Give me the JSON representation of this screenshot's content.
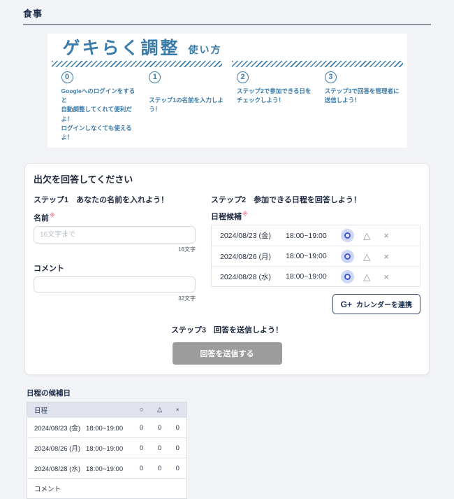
{
  "colors": {
    "accent_blue": "#3b7ca9",
    "selected_blue": "#4457d2",
    "selected_halo": "#cdd7f7",
    "required_red": "#ee8296",
    "disabled_gray": "#9c9c9c",
    "navy_text": "#1b2a4a",
    "page_background": "#f2f3f6"
  },
  "page": {
    "title": "食事"
  },
  "banner": {
    "title": "ゲキらく調整",
    "subtitle": "使い方",
    "steps": [
      {
        "number": "0",
        "lines": [
          "Googleへのログインをすると",
          "自動調整してくれて便利だよ！",
          "ログインしなくても使えるよ！"
        ]
      },
      {
        "number": "1",
        "lines": [
          "ステップ1の名前を入力しよう！"
        ]
      },
      {
        "number": "2",
        "lines": [
          "ステップ2で参加できる日を",
          "チェックしよう！"
        ]
      },
      {
        "number": "3",
        "lines": [
          "ステップ3で回答を管理者に",
          "送信しよう！"
        ]
      }
    ]
  },
  "form": {
    "title": "出欠を回答してください",
    "step1": {
      "heading": "ステップ1　あなたの名前を入れよう！",
      "name_label": "名前",
      "required_mark": "※",
      "name_placeholder": "16文字まで",
      "name_value": "",
      "name_counter": "16文字",
      "comment_label": "コメント",
      "comment_value": "",
      "comment_counter": "32文字"
    },
    "step2": {
      "heading": "ステップ2　参加できる日程を回答しよう！",
      "list_label": "日程候補",
      "required_mark": "※",
      "options": {
        "circle": "○",
        "triangle": "△",
        "cross": "×"
      },
      "dates": [
        {
          "date": "2024/08/23 (金)",
          "time": "18:00~19:00",
          "selected": "○"
        },
        {
          "date": "2024/08/26 (月)",
          "time": "18:00~19:00",
          "selected": "○"
        },
        {
          "date": "2024/08/28 (水)",
          "time": "18:00~19:00",
          "selected": "○"
        }
      ],
      "calendar_button": {
        "icon": "G+",
        "label": "カレンダーを連携"
      }
    },
    "step3": {
      "heading": "ステップ3　回答を送信しよう！",
      "submit_label": "回答を送信する"
    }
  },
  "summary": {
    "title": "日程の候補日",
    "columns": {
      "date": "日程",
      "circle": "○",
      "triangle": "△",
      "cross": "×"
    },
    "rows": [
      {
        "date": "2024/08/23 (金)",
        "time": "18:00~19:00",
        "circle": 0,
        "triangle": 0,
        "cross": 0
      },
      {
        "date": "2024/08/26 (月)",
        "time": "18:00~19:00",
        "circle": 0,
        "triangle": 0,
        "cross": 0
      },
      {
        "date": "2024/08/28 (水)",
        "time": "18:00~19:00",
        "circle": 0,
        "triangle": 0,
        "cross": 0
      }
    ],
    "comment_label": "コメント"
  }
}
